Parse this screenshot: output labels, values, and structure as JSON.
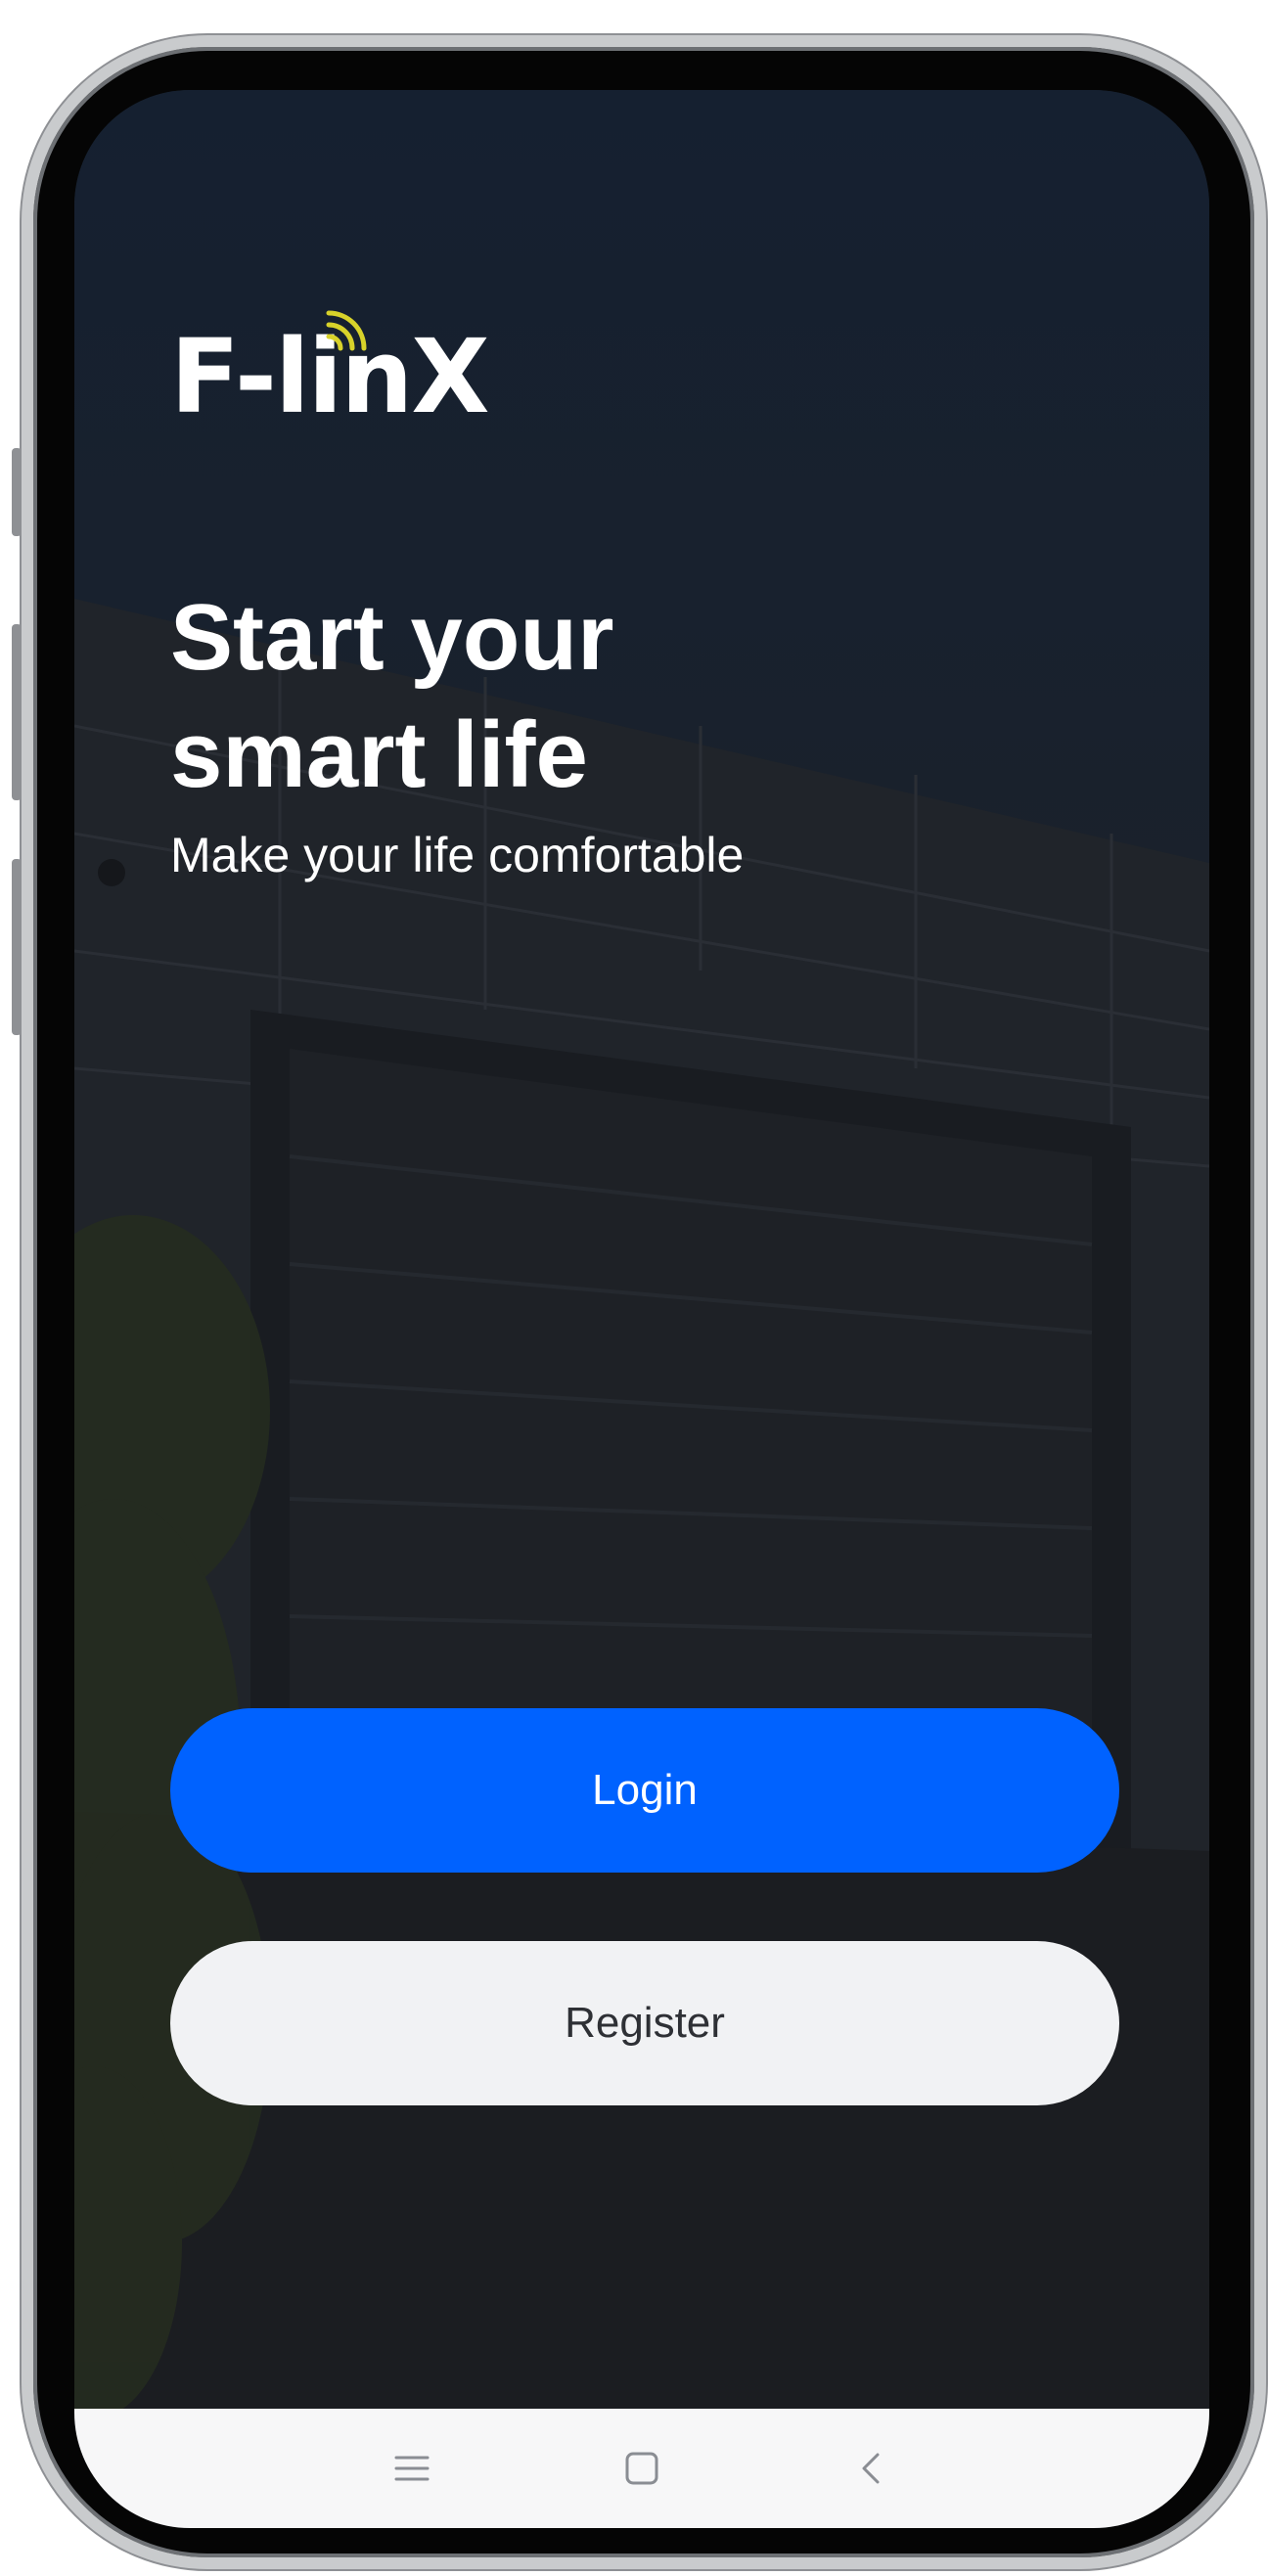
{
  "app": {
    "brand_name": "F-linX"
  },
  "hero": {
    "headline_line1": "Start your",
    "headline_line2": "smart life",
    "subtitle": "Make your life comfortable"
  },
  "actions": {
    "login_label": "Login",
    "register_label": "Register"
  },
  "nav": {
    "items": [
      {
        "icon": "menu-lines-icon"
      },
      {
        "icon": "home-square-icon"
      },
      {
        "icon": "back-chevron-icon"
      }
    ]
  },
  "colors": {
    "primary": "#0062ff",
    "secondary_button": "#f1f2f4",
    "wifi_accent": "#d8d22a",
    "background": "#151a22"
  }
}
